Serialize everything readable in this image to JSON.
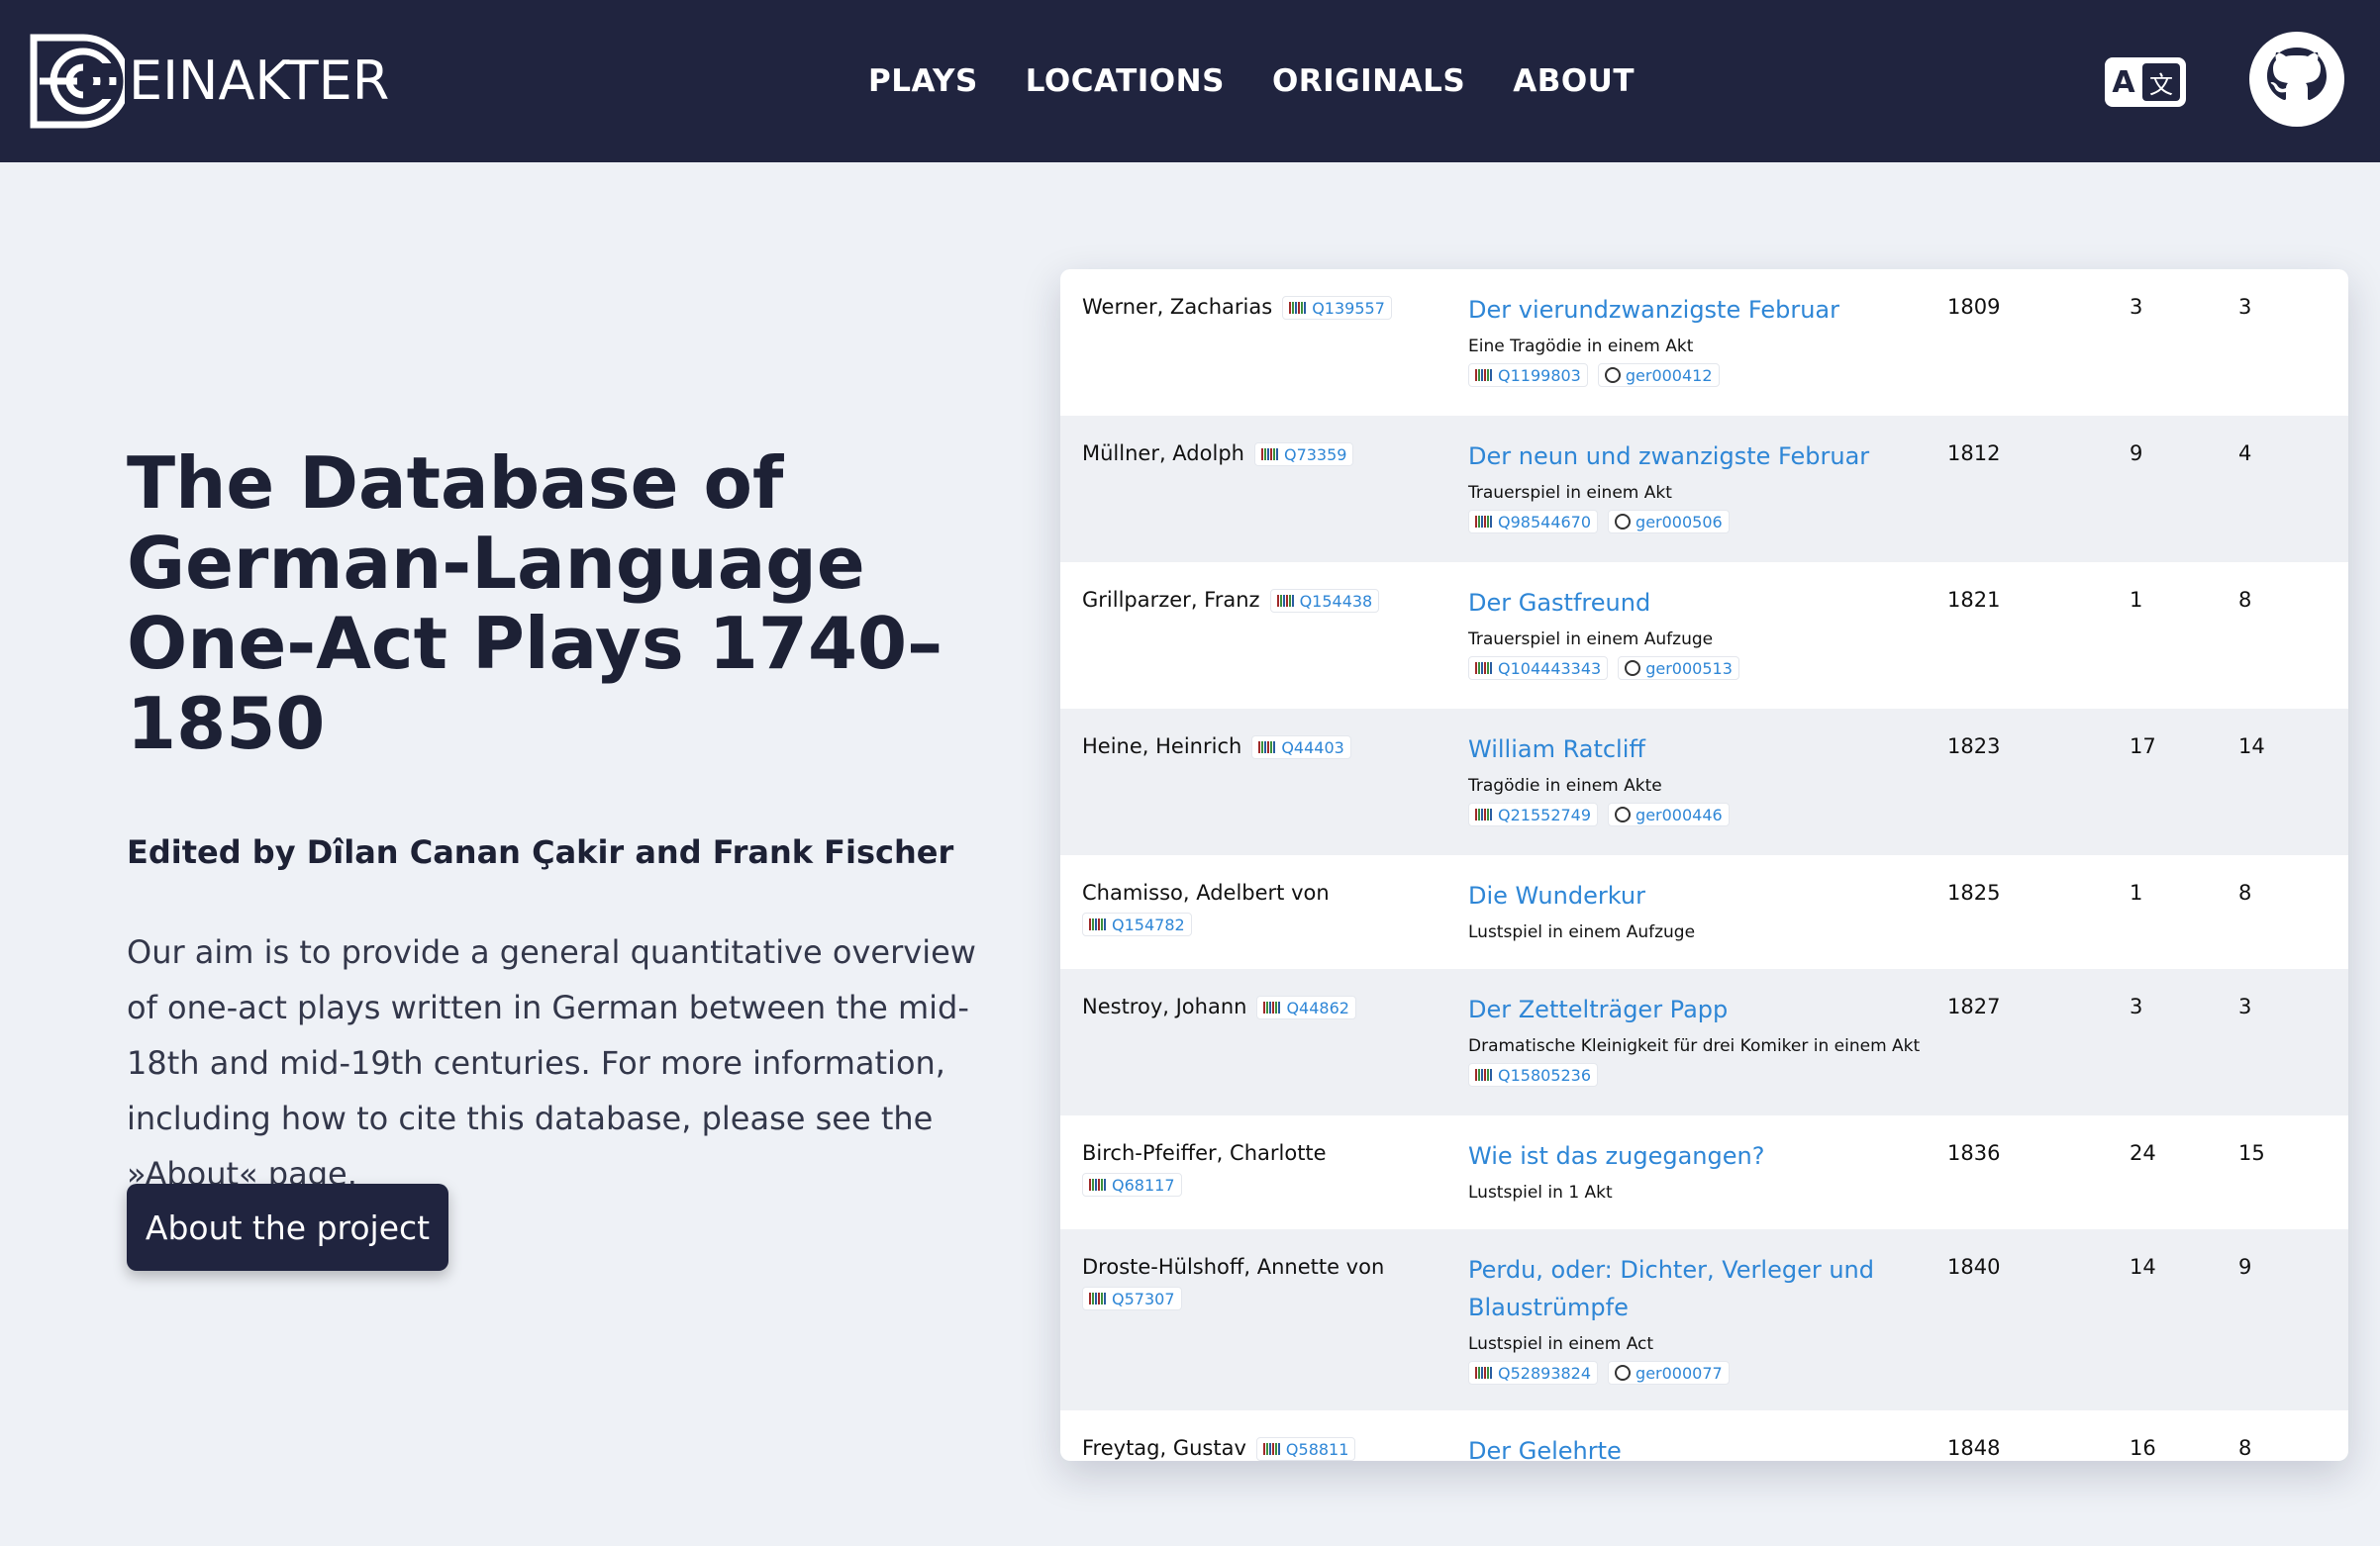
{
  "brand": {
    "name": "EINAKTER"
  },
  "nav": {
    "items": [
      "PLAYS",
      "LOCATIONS",
      "ORIGINALS",
      "ABOUT"
    ]
  },
  "header": {
    "translate_icon": "translate-icon",
    "github_icon": "github-icon",
    "translate_a": "A",
    "translate_z": "文"
  },
  "hero": {
    "title": "The Database of German-Language One-Act Plays 1740–1850",
    "editors": "Edited by Dîlan Canan Çakir and Frank Fischer",
    "intro": "Our aim is to provide a general quantitative overview of one-act plays written in German between the mid-18th and mid-19th centuries. For more information, including how to cite this database, please see the »About« page.",
    "button": "About the project"
  },
  "plays": [
    {
      "author": "Werner, Zacharias",
      "author_wd": "Q139557",
      "title": "Der vierundzwanzigste Februar",
      "subtitle": "Eine Tragödie in einem Akt",
      "play_wd": "Q1199803",
      "dracor": "ger000412",
      "year": "1809",
      "c1": "3",
      "c2": "3"
    },
    {
      "author": "Müllner, Adolph",
      "author_wd": "Q73359",
      "title": "Der neun und zwanzigste Februar",
      "subtitle": "Trauerspiel in einem Akt",
      "play_wd": "Q98544670",
      "dracor": "ger000506",
      "year": "1812",
      "c1": "9",
      "c2": "4"
    },
    {
      "author": "Grillparzer, Franz",
      "author_wd": "Q154438",
      "title": "Der Gastfreund",
      "subtitle": "Trauerspiel in einem Aufzuge",
      "play_wd": "Q104443343",
      "dracor": "ger000513",
      "year": "1821",
      "c1": "1",
      "c2": "8"
    },
    {
      "author": "Heine, Heinrich",
      "author_wd": "Q44403",
      "title": "William Ratcliff",
      "subtitle": "Tragödie in einem Akte",
      "play_wd": "Q21552749",
      "dracor": "ger000446",
      "year": "1823",
      "c1": "17",
      "c2": "14"
    },
    {
      "author": "Chamisso, Adelbert von",
      "author_wd": "Q154782",
      "title": "Die Wunderkur",
      "subtitle": "Lustspiel in einem Aufzuge",
      "year": "1825",
      "c1": "1",
      "c2": "8"
    },
    {
      "author": "Nestroy, Johann",
      "author_wd": "Q44862",
      "title": "Der Zettelträger Papp",
      "subtitle": "Dramatische Kleinigkeit für drei Komiker in einem Akt",
      "play_wd": "Q15805236",
      "year": "1827",
      "c1": "3",
      "c2": "3"
    },
    {
      "author": "Birch-Pfeiffer, Charlotte",
      "author_wd": "Q68117",
      "title": "Wie ist das zugegangen?",
      "subtitle": "Lustspiel in 1 Akt",
      "year": "1836",
      "c1": "24",
      "c2": "15"
    },
    {
      "author": "Droste-Hülshoff, Annette von",
      "author_wd": "Q57307",
      "title": "Perdu, oder: Dichter, Verleger und Blaustrümpfe",
      "subtitle": "Lustspiel in einem Act",
      "play_wd": "Q52893824",
      "dracor": "ger000077",
      "year": "1840",
      "c1": "14",
      "c2": "9"
    },
    {
      "author": "Freytag, Gustav",
      "author_wd": "Q58811",
      "title": "Der Gelehrte",
      "year": "1848",
      "c1": "16",
      "c2": "8"
    }
  ]
}
